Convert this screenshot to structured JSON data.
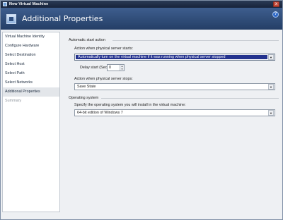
{
  "window": {
    "title": "New Virtual Machine",
    "close_glyph": "x",
    "app_icon": "vm-app-icon"
  },
  "banner": {
    "title": "Additional Properties",
    "icon": "properties-icon",
    "help_glyph": "?"
  },
  "nav": {
    "items": [
      {
        "label": "Virtual Machine Identity",
        "state": "normal"
      },
      {
        "label": "Configure Hardware",
        "state": "normal"
      },
      {
        "label": "Select Destination",
        "state": "normal"
      },
      {
        "label": "Select Host",
        "state": "normal"
      },
      {
        "label": "Select Path",
        "state": "normal"
      },
      {
        "label": "Select Networks",
        "state": "normal"
      },
      {
        "label": "Additional Properties",
        "state": "selected"
      },
      {
        "label": "Summary",
        "state": "disabled"
      }
    ]
  },
  "auto_start": {
    "section_title": "Automatic start action",
    "start_label": "Action when physical server starts:",
    "start_value": "Automatically turn on the virtual machine if it was running when physical server stopped",
    "delay_label": "Delay start (Sec):",
    "delay_value": "0",
    "stop_label": "Action when physical server stops:",
    "stop_value": "Save State"
  },
  "os": {
    "section_title": "Operating system",
    "label": "Specify the operating system you will install in the virtual machine:",
    "value": "64-bit edition of Windows 7"
  },
  "glyphs": {
    "dropdown": "▼",
    "up": "▲",
    "down": "▼"
  }
}
